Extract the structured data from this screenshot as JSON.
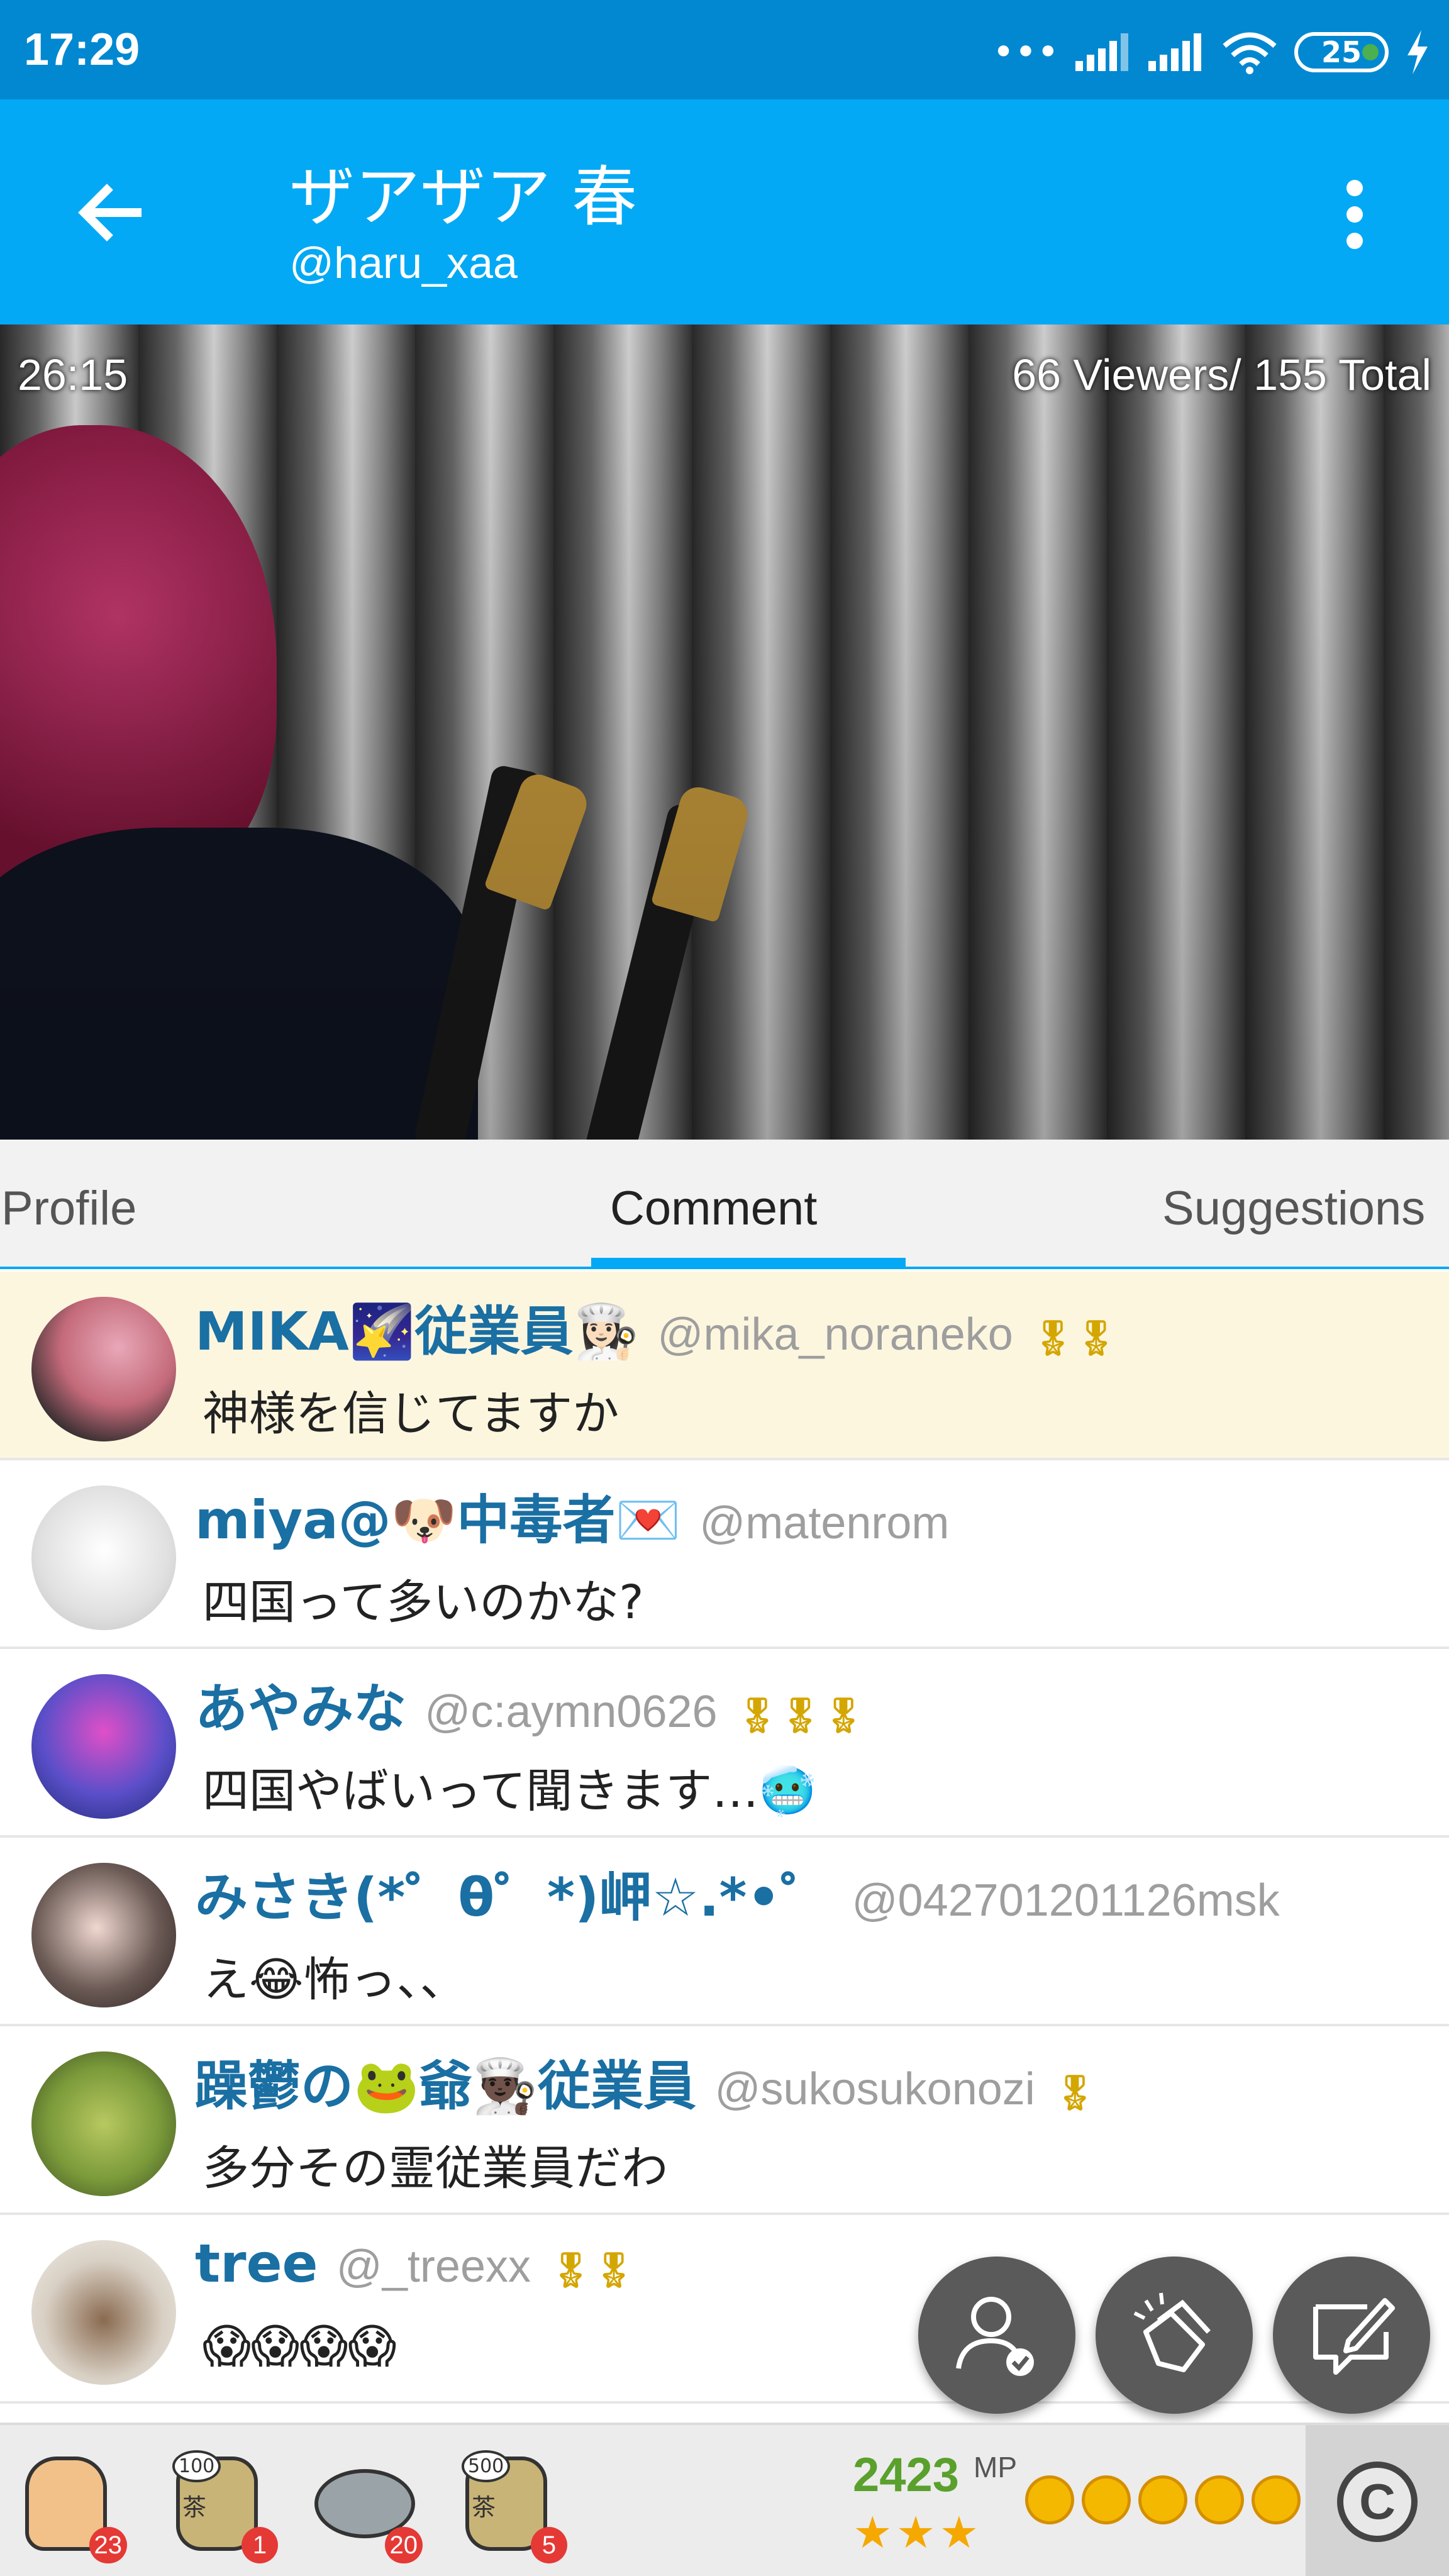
{
  "status_bar": {
    "time": "17:29",
    "signal_dots": "•••",
    "battery": "25"
  },
  "app_bar": {
    "title": "ザアザア 春",
    "subtitle": "@haru_xaa"
  },
  "video": {
    "elapsed": "26:15",
    "viewers": "66 Viewers/ 155 Total"
  },
  "tabs": [
    {
      "label": "Profile",
      "active": false
    },
    {
      "label": "Comment",
      "active": true
    },
    {
      "label": "Suggestions",
      "active": false
    }
  ],
  "comments": [
    {
      "name": "MIKA🌠従業員👩🏻‍🍳",
      "handle": "@mika_noraneko",
      "medals": "🎖🎖",
      "text": "神様を信じてますか",
      "highlight": true,
      "avatar_color": "#c46a7a"
    },
    {
      "name": "miya@🐶中毒者💌",
      "handle": "@matenrom",
      "medals": "",
      "text": "四国って多いのかな?",
      "highlight": false,
      "avatar_color": "#e8e8e8"
    },
    {
      "name": "あやみな",
      "handle": "@c:aymn0626",
      "medals": "🎖🎖🎖",
      "text": "四国やばいって聞きます…🥶",
      "highlight": false,
      "avatar_color": "#5b4fc9"
    },
    {
      "name": "みさき(*゜θ゜*)岬☆.*•゜",
      "handle": "@042701201126msk",
      "medals": "",
      "text": "え😂怖っ、、",
      "highlight": false,
      "avatar_color": "#6b5a55"
    },
    {
      "name": "躁鬱の🐸爺👨🏿‍🍳従業員",
      "handle": "@sukosukonozi",
      "medals": "🎖",
      "text": "多分その霊従業員だわ",
      "highlight": false,
      "avatar_color": "#7a9a3a"
    },
    {
      "name": "tree",
      "handle": "@_treexx",
      "medals": "🎖🎖",
      "text": "😱😱😱😱",
      "highlight": false,
      "avatar_color": "#d8d0c4"
    }
  ],
  "fab_icons": [
    "follow-user-icon",
    "clap-icon",
    "write-comment-icon"
  ],
  "gifts": [
    {
      "kind": "clap",
      "label": "",
      "small": "",
      "count": "23"
    },
    {
      "kind": "tea",
      "label": "茶",
      "small": "100",
      "count": "1"
    },
    {
      "kind": "disc",
      "label": "",
      "small": "",
      "count": "20"
    },
    {
      "kind": "tea",
      "label": "茶",
      "small": "500",
      "count": "5"
    }
  ],
  "points": {
    "value": "2423",
    "unit": "MP",
    "stars": "★★★",
    "coins": 5
  },
  "c_button": "C"
}
